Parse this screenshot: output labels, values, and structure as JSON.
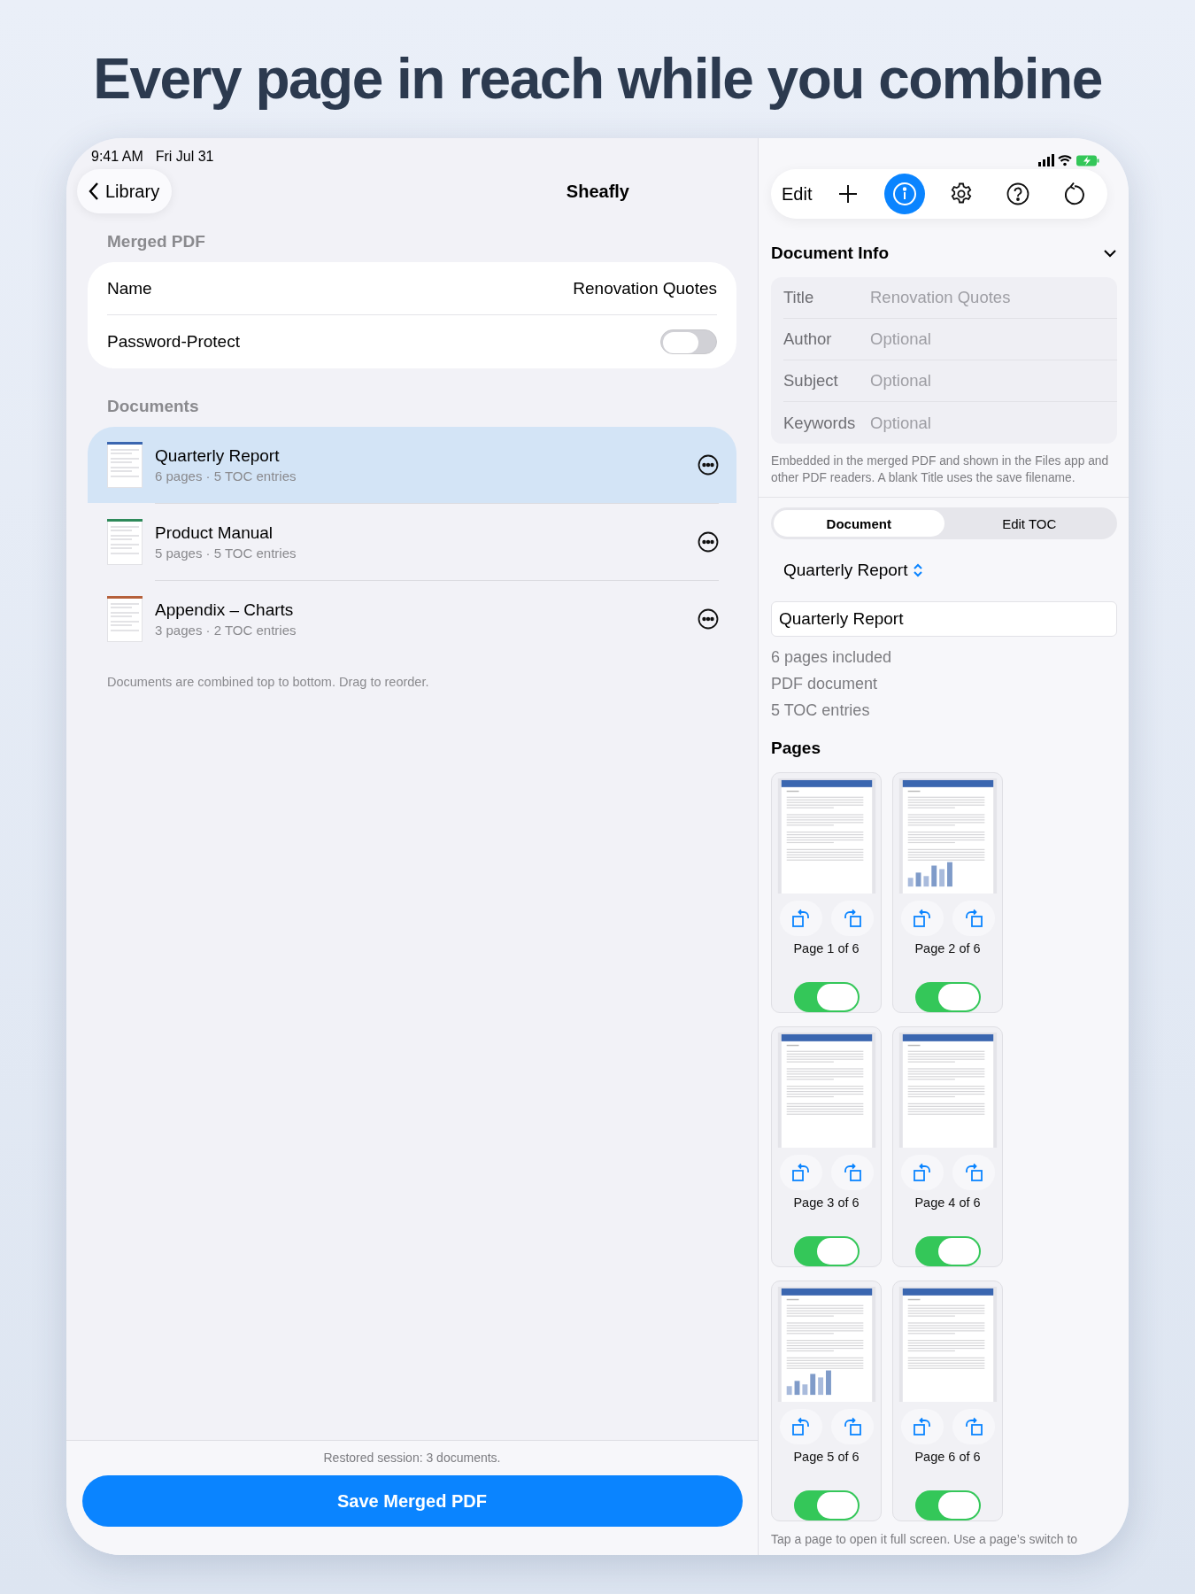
{
  "headline": "Every page in reach while you combine",
  "status_bar": {
    "time": "9:41 AM",
    "date": "Fri Jul 31"
  },
  "nav": {
    "back_label": "Library",
    "title": "Sheafly"
  },
  "merged_pdf": {
    "header": "Merged PDF",
    "name_label": "Name",
    "name_value": "Renovation Quotes",
    "password_label": "Password-Protect",
    "password_on": false
  },
  "documents": {
    "header": "Documents",
    "items": [
      {
        "title": "Quarterly Report",
        "meta": "6 pages · 5 TOC entries",
        "color": "#3a66b0",
        "selected": true
      },
      {
        "title": "Product Manual",
        "meta": "5 pages · 5 TOC entries",
        "color": "#2e8a5a",
        "selected": false
      },
      {
        "title": "Appendix – Charts",
        "meta": "3 pages · 2 TOC entries",
        "color": "#b5603a",
        "selected": false
      }
    ],
    "footnote": "Documents are combined top to bottom. Drag to reorder."
  },
  "bottom": {
    "status": "Restored session: 3 documents.",
    "save_label": "Save Merged PDF"
  },
  "toolbar": {
    "edit_label": "Edit",
    "buttons": [
      {
        "kind": "add",
        "selected": false
      },
      {
        "kind": "info",
        "selected": true
      },
      {
        "kind": "settings",
        "selected": false
      },
      {
        "kind": "help",
        "selected": false
      },
      {
        "kind": "reset",
        "selected": false
      }
    ]
  },
  "document_info": {
    "title": "Document Info",
    "expanded": true,
    "fields": [
      {
        "label": "Title",
        "placeholder": "Renovation Quotes"
      },
      {
        "label": "Author",
        "placeholder": "Optional"
      },
      {
        "label": "Subject",
        "placeholder": "Optional"
      },
      {
        "label": "Keywords",
        "placeholder": "Optional"
      }
    ],
    "note": "Embedded in the merged PDF and shown in the Files app and other PDF readers. A blank Title uses the save filename."
  },
  "segments": [
    {
      "label": "Document",
      "selected": true
    },
    {
      "label": "Edit TOC",
      "selected": false
    }
  ],
  "document_picker": "Quarterly Report",
  "document_name_value": "Quarterly Report",
  "details": [
    "6 pages included",
    "PDF document",
    "5 TOC entries"
  ],
  "pages": {
    "title": "Pages",
    "items": [
      {
        "label": "Page 1 of 6",
        "chart": false,
        "on": true
      },
      {
        "label": "Page 2 of 6",
        "chart": true,
        "on": true
      },
      {
        "label": "Page 3 of 6",
        "chart": false,
        "on": true
      },
      {
        "label": "Page 4 of 6",
        "chart": false,
        "on": true
      },
      {
        "label": "Page 5 of 6",
        "chart": true,
        "on": true
      },
      {
        "label": "Page 6 of 6",
        "chart": false,
        "on": true
      }
    ],
    "footnote": "Tap a page to open it full screen. Use a page’s switch to"
  }
}
